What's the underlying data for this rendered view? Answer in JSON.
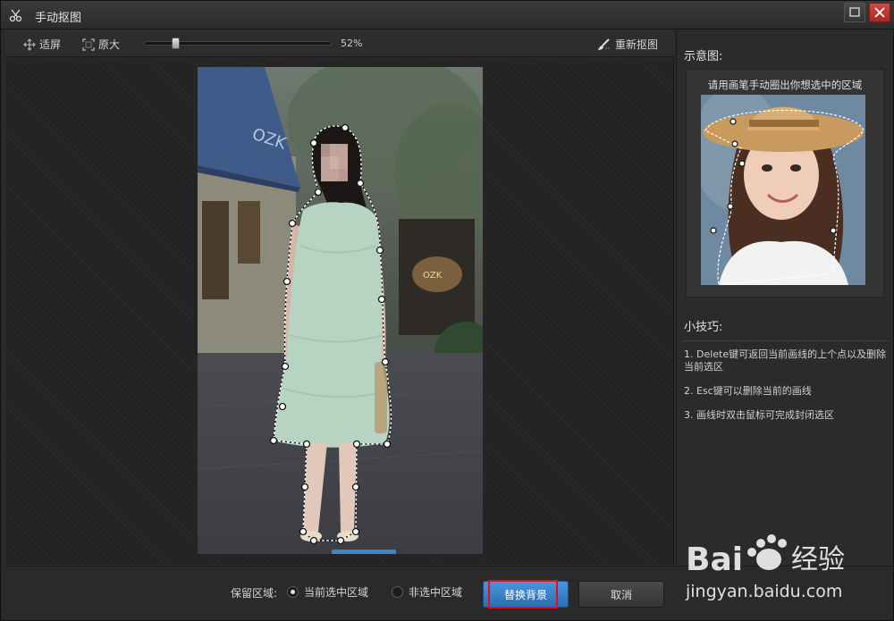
{
  "window": {
    "title": "手动抠图"
  },
  "toolbar": {
    "fit_label": "适屏",
    "original_label": "原大",
    "zoom_percent": "52%",
    "zoom_value": 0.15,
    "redraw_label": "重新抠图"
  },
  "panel": {
    "sample_title": "示意图:",
    "sample_caption": "请用画笔手动圈出你想选中的区域",
    "tips_title": "小技巧:",
    "tips": [
      "1. Delete键可返回当前画线的上个点以及删除当前选区",
      "2. Esc键可以删除当前的画线",
      "3. 画线时双击鼠标可完成封闭选区"
    ]
  },
  "bottom": {
    "keep_label": "保留区域:",
    "option_selected": "当前选中区域",
    "option_unselected": "非选中区域",
    "replace_button": "替换背景",
    "cancel_button": "取消"
  },
  "watermark": {
    "brand": "Bai",
    "brand2": "经验",
    "url": "jingyan.baidu.com"
  },
  "colors": {
    "accent": "#3b84cf",
    "highlight": "#e0101a",
    "dress": "#b7d4c3"
  }
}
